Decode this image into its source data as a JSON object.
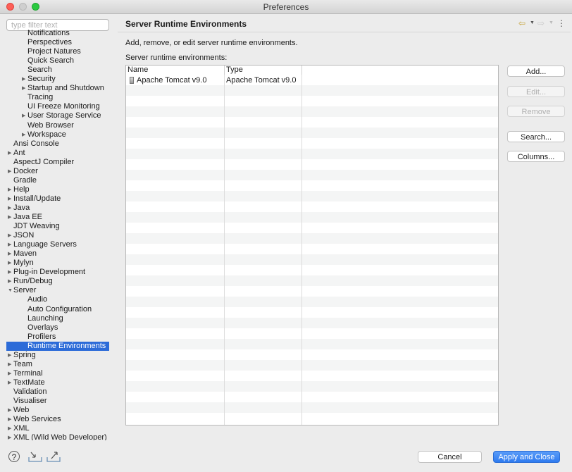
{
  "window": {
    "title": "Preferences"
  },
  "filter": {
    "placeholder": "type filter text"
  },
  "tree": [
    {
      "label": "Notifications",
      "level": 1,
      "arrow": false
    },
    {
      "label": "Perspectives",
      "level": 1,
      "arrow": false
    },
    {
      "label": "Project Natures",
      "level": 1,
      "arrow": false
    },
    {
      "label": "Quick Search",
      "level": 1,
      "arrow": false
    },
    {
      "label": "Search",
      "level": 1,
      "arrow": false
    },
    {
      "label": "Security",
      "level": 1,
      "arrow": "collapsed"
    },
    {
      "label": "Startup and Shutdown",
      "level": 1,
      "arrow": "collapsed"
    },
    {
      "label": "Tracing",
      "level": 1,
      "arrow": false
    },
    {
      "label": "UI Freeze Monitoring",
      "level": 1,
      "arrow": false
    },
    {
      "label": "User Storage Service",
      "level": 1,
      "arrow": "collapsed"
    },
    {
      "label": "Web Browser",
      "level": 1,
      "arrow": false
    },
    {
      "label": "Workspace",
      "level": 1,
      "arrow": "collapsed"
    },
    {
      "label": "Ansi Console",
      "level": 0,
      "arrow": false
    },
    {
      "label": "Ant",
      "level": 0,
      "arrow": "collapsed"
    },
    {
      "label": "AspectJ Compiler",
      "level": 0,
      "arrow": false
    },
    {
      "label": "Docker",
      "level": 0,
      "arrow": "collapsed"
    },
    {
      "label": "Gradle",
      "level": 0,
      "arrow": false
    },
    {
      "label": "Help",
      "level": 0,
      "arrow": "collapsed"
    },
    {
      "label": "Install/Update",
      "level": 0,
      "arrow": "collapsed"
    },
    {
      "label": "Java",
      "level": 0,
      "arrow": "collapsed"
    },
    {
      "label": "Java EE",
      "level": 0,
      "arrow": "collapsed"
    },
    {
      "label": "JDT Weaving",
      "level": 0,
      "arrow": false
    },
    {
      "label": "JSON",
      "level": 0,
      "arrow": "collapsed"
    },
    {
      "label": "Language Servers",
      "level": 0,
      "arrow": "collapsed"
    },
    {
      "label": "Maven",
      "level": 0,
      "arrow": "collapsed"
    },
    {
      "label": "Mylyn",
      "level": 0,
      "arrow": "collapsed"
    },
    {
      "label": "Plug-in Development",
      "level": 0,
      "arrow": "collapsed"
    },
    {
      "label": "Run/Debug",
      "level": 0,
      "arrow": "collapsed"
    },
    {
      "label": "Server",
      "level": 0,
      "arrow": "expanded"
    },
    {
      "label": "Audio",
      "level": 1,
      "arrow": false
    },
    {
      "label": "Auto Configuration",
      "level": 1,
      "arrow": false
    },
    {
      "label": "Launching",
      "level": 1,
      "arrow": false
    },
    {
      "label": "Overlays",
      "level": 1,
      "arrow": false
    },
    {
      "label": "Profilers",
      "level": 1,
      "arrow": false
    },
    {
      "label": "Runtime Environments",
      "level": 1,
      "arrow": false,
      "selected": true
    },
    {
      "label": "Spring",
      "level": 0,
      "arrow": "collapsed"
    },
    {
      "label": "Team",
      "level": 0,
      "arrow": "collapsed"
    },
    {
      "label": "Terminal",
      "level": 0,
      "arrow": "collapsed"
    },
    {
      "label": "TextMate",
      "level": 0,
      "arrow": "collapsed"
    },
    {
      "label": "Validation",
      "level": 0,
      "arrow": false
    },
    {
      "label": "Visualiser",
      "level": 0,
      "arrow": false
    },
    {
      "label": "Web",
      "level": 0,
      "arrow": "collapsed"
    },
    {
      "label": "Web Services",
      "level": 0,
      "arrow": "collapsed"
    },
    {
      "label": "XML",
      "level": 0,
      "arrow": "collapsed"
    },
    {
      "label": "XML (Wild Web Developer)",
      "level": 0,
      "arrow": "collapsed"
    }
  ],
  "page": {
    "title": "Server Runtime Environments",
    "description": "Add, remove, or edit server runtime environments.",
    "table_label": "Server runtime environments:"
  },
  "table": {
    "columns": [
      "Name",
      "Type"
    ],
    "rows": [
      {
        "name": "Apache Tomcat v9.0",
        "type": "Apache Tomcat v9.0"
      }
    ]
  },
  "buttons": {
    "add": "Add...",
    "edit": "Edit...",
    "remove": "Remove",
    "search": "Search...",
    "columns": "Columns..."
  },
  "footer": {
    "cancel": "Cancel",
    "apply_close": "Apply and Close"
  },
  "icons": {
    "back": "back-arrow-icon",
    "forward": "forward-arrow-icon",
    "menu": "view-menu-icon",
    "help": "help-icon",
    "import": "import-icon",
    "export": "export-icon",
    "server": "server-icon"
  },
  "colors": {
    "selection": "#2c6bd8",
    "primary_button": "#2f7bf0",
    "nav_arrow": "#c6a33a"
  }
}
